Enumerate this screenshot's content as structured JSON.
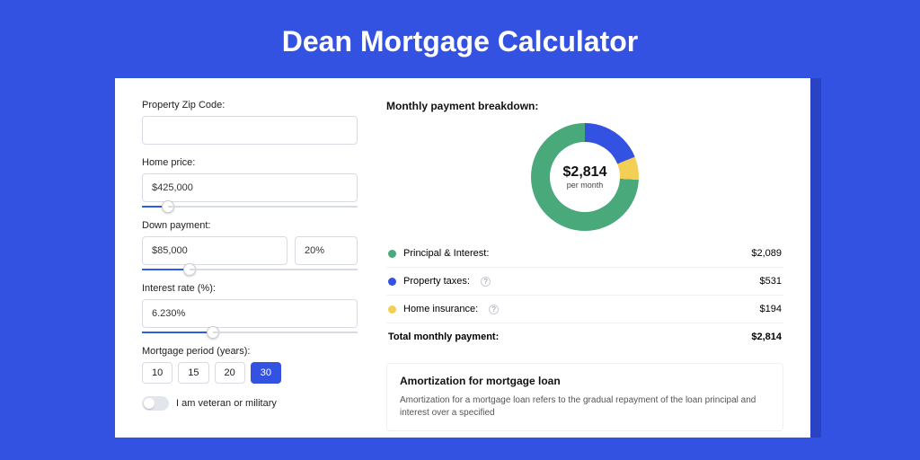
{
  "title": "Dean Mortgage Calculator",
  "form": {
    "zip_label": "Property Zip Code:",
    "zip_value": "",
    "home_price_label": "Home price:",
    "home_price_value": "$425,000",
    "down_payment_label": "Down payment:",
    "down_payment_amount": "$85,000",
    "down_payment_percent": "20%",
    "interest_label": "Interest rate (%):",
    "interest_value": "6.230%",
    "period_label": "Mortgage period (years):",
    "periods": [
      "10",
      "15",
      "20",
      "30"
    ],
    "period_selected": "30",
    "veteran_label": "I am veteran or military",
    "veteran_on": false
  },
  "breakdown": {
    "title": "Monthly payment breakdown:",
    "monthly_amount": "$2,814",
    "monthly_sub": "per month",
    "items": [
      {
        "label": "Principal & Interest:",
        "value": "$2,089",
        "color": "green",
        "info": false
      },
      {
        "label": "Property taxes:",
        "value": "$531",
        "color": "blue",
        "info": true
      },
      {
        "label": "Home insurance:",
        "value": "$194",
        "color": "yellow",
        "info": true
      }
    ],
    "total_label": "Total monthly payment:",
    "total_value": "$2,814"
  },
  "amortization": {
    "title": "Amortization for mortgage loan",
    "text": "Amortization for a mortgage loan refers to the gradual repayment of the loan principal and interest over a specified"
  },
  "chart_data": {
    "type": "pie",
    "title": "Monthly payment breakdown",
    "series": [
      {
        "name": "Principal & Interest",
        "value": 2089,
        "color": "#4aa97b"
      },
      {
        "name": "Property taxes",
        "value": 531,
        "color": "#3452e1"
      },
      {
        "name": "Home insurance",
        "value": 194,
        "color": "#f3cf55"
      }
    ],
    "total": 2814,
    "center_label": "$2,814 per month"
  }
}
